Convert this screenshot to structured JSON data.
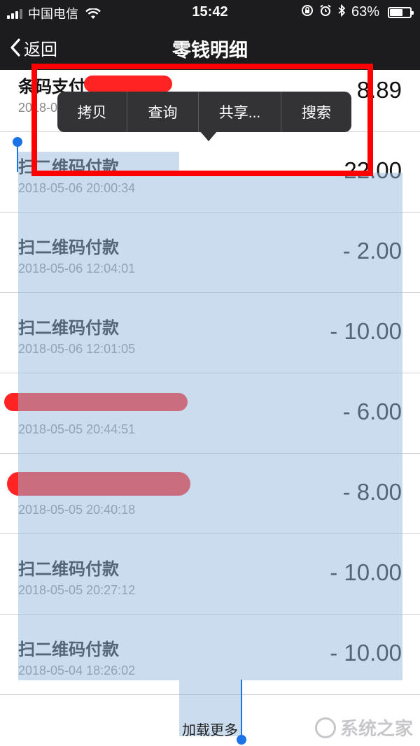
{
  "status_bar": {
    "carrier": "中国电信",
    "time": "15:42",
    "battery": "63%",
    "battery_level": 0.63
  },
  "nav": {
    "back_label": "返回",
    "title": "零钱明细"
  },
  "context_menu": {
    "items": [
      "拷贝",
      "查询",
      "共享...",
      "搜索"
    ]
  },
  "transactions": [
    {
      "title": "条码支付",
      "time": "2018-0",
      "amount": "8.89"
    },
    {
      "title": "扫二维码付款",
      "time": "2018-05-06 20:00:34",
      "amount": "22.00"
    },
    {
      "title": "扫二维码付款",
      "time": "2018-05-06 12:04:01",
      "amount": "- 2.00"
    },
    {
      "title": "扫二维码付款",
      "time": "2018-05-06 12:01:05",
      "amount": "- 10.00"
    },
    {
      "title": "",
      "time": "2018-05-05 20:44:51",
      "amount": "- 6.00"
    },
    {
      "title": "",
      "time": "2018-05-05 20:40:18",
      "amount": "- 8.00"
    },
    {
      "title": "扫二维码付款",
      "time": "2018-05-05 20:27:12",
      "amount": "- 10.00"
    },
    {
      "title": "扫二维码付款",
      "time": "2018-05-04 18:26:02",
      "amount": "- 10.00"
    }
  ],
  "load_more": "加载更多",
  "watermark": "系统之家"
}
